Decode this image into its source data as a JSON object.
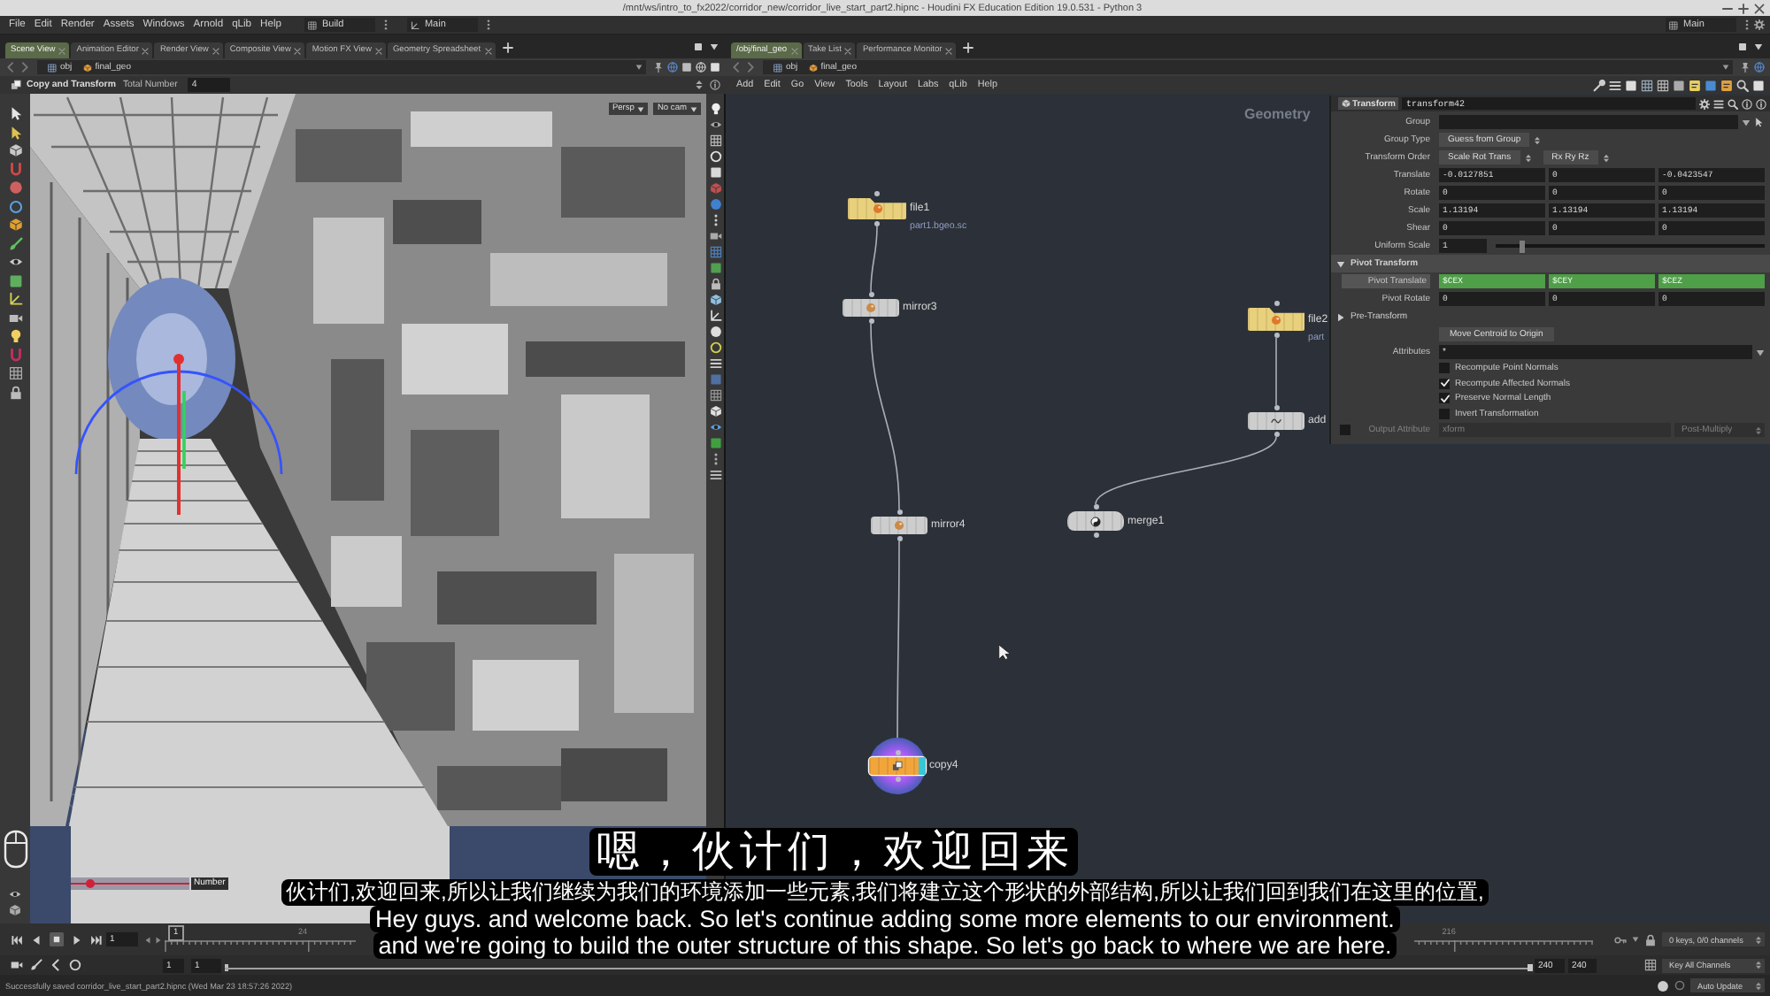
{
  "window": {
    "title": "/mnt/ws/intro_to_fx2022/corridor_new/corridor_live_start_part2.hipnc - Houdini FX Education Edition 19.0.531 - Python 3"
  },
  "menu": [
    "File",
    "Edit",
    "Render",
    "Assets",
    "Windows",
    "Arnold",
    "qLib",
    "Help"
  ],
  "desktops": [
    "Build",
    "Main"
  ],
  "desktop_right": "Main",
  "left_pane": {
    "tabs": [
      {
        "label": "Scene View",
        "selected": true
      },
      {
        "label": "Animation Editor",
        "selected": false
      },
      {
        "label": "Render View",
        "selected": false
      },
      {
        "label": "Composite View",
        "selected": false
      },
      {
        "label": "Motion FX View",
        "selected": false
      },
      {
        "label": "Geometry Spreadsheet",
        "selected": false
      }
    ],
    "path": [
      "obj",
      "final_geo"
    ],
    "tool": {
      "name": "Copy and Transform",
      "param_label": "Total Number",
      "param_value": "4"
    },
    "viewport": {
      "camera_menus": [
        "Persp",
        "No cam"
      ],
      "handle": {
        "label": "Number",
        "level": 0.16
      }
    }
  },
  "right_pane": {
    "tabs": [
      {
        "label": "/obj/final_geo",
        "selected": true
      },
      {
        "label": "Take List",
        "selected": false
      },
      {
        "label": "Performance Monitor",
        "selected": false
      }
    ],
    "path": [
      "obj",
      "final_geo"
    ],
    "menu": [
      "Add",
      "Edit",
      "Go",
      "View",
      "Tools",
      "Layout",
      "Labs",
      "qLib",
      "Help"
    ],
    "network": {
      "context": "Geometry",
      "nodes": [
        {
          "kind": "file",
          "name": "file1",
          "detail": "part1.bgeo.sc",
          "color": "#e8d07c",
          "selected": false,
          "display": false
        },
        {
          "kind": "mirror",
          "name": "mirror3",
          "color": "#cdcdcd",
          "selected": false,
          "display": false
        },
        {
          "kind": "file",
          "name": "file2",
          "detail": "part",
          "color": "#e8d07c",
          "selected": false,
          "display": false
        },
        {
          "kind": "add",
          "name": "add",
          "color": "#cdcdcd",
          "selected": false,
          "display": false
        },
        {
          "kind": "merge",
          "name": "merge1",
          "color": "#cdcdcd",
          "selected": false,
          "display": false
        },
        {
          "kind": "mirror",
          "name": "mirror4",
          "color": "#cdcdcd",
          "selected": false,
          "display": false
        },
        {
          "kind": "copy",
          "name": "copy4",
          "color": "#f2a53a",
          "selected": true,
          "display": true
        }
      ]
    },
    "parameters": {
      "node_type": "Transform",
      "node_name": "transform42",
      "rows": [
        {
          "kind": "group",
          "label": "Group"
        },
        {
          "kind": "menu",
          "label": "Group Type",
          "values": [
            "Guess from Group"
          ]
        },
        {
          "kind": "menu",
          "label": "Transform Order",
          "values": [
            "Scale Rot Trans",
            "Rx Ry Rz"
          ]
        },
        {
          "kind": "vector",
          "label": "Translate",
          "values": [
            "-0.0127851",
            "0",
            "-0.0423547"
          ],
          "expression": false
        },
        {
          "kind": "vector",
          "label": "Rotate",
          "values": [
            "0",
            "0",
            "0"
          ],
          "expression": false
        },
        {
          "kind": "vector",
          "label": "Scale",
          "values": [
            "1.13194",
            "1.13194",
            "1.13194"
          ],
          "expression": false
        },
        {
          "kind": "vector",
          "label": "Shear",
          "values": [
            "0",
            "0",
            "0"
          ],
          "expression": false
        },
        {
          "kind": "slider",
          "label": "Uniform Scale",
          "value": "1",
          "level": 0.1
        },
        {
          "kind": "section",
          "label": "Pivot Transform",
          "expanded": true
        },
        {
          "kind": "vector",
          "label": "Pivot Translate",
          "values": [
            "$CEX",
            "$CEY",
            "$CEZ"
          ],
          "expression": true
        },
        {
          "kind": "vector",
          "label": "Pivot Rotate",
          "values": [
            "0",
            "0",
            "0"
          ],
          "expression": false
        },
        {
          "kind": "section",
          "label": "Pre-Transform",
          "expanded": false
        },
        {
          "kind": "button",
          "label": "Move Centroid to Origin"
        },
        {
          "kind": "field",
          "label": "Attributes",
          "value": "*"
        },
        {
          "kind": "checkbox",
          "label": "Recompute Point Normals",
          "checked": false
        },
        {
          "kind": "checkbox",
          "label": "Recompute Affected Normals",
          "checked": true
        },
        {
          "kind": "checkbox",
          "label": "Preserve Normal Length",
          "checked": true
        },
        {
          "kind": "checkbox",
          "label": "Invert Transformation",
          "checked": false
        },
        {
          "kind": "toggle_field",
          "label": "Output Attribute",
          "checked": false,
          "disabled": true,
          "value": "xform",
          "menu": "Post-Multiply"
        }
      ]
    }
  },
  "captions": {
    "headline": "嗯，伙计们，欢迎回来",
    "chinese": "伙计们,欢迎回来,所以让我们继续为我们的环境添加一些元素,我们将建立这个形状的外部结构,所以让我们回到我们在这里的位置,",
    "english": [
      "Hey guys. and welcome back. So let's continue adding some more elements to our environment.",
      "and we're going to build the outer structure of this shape. So let's go back to where we are here."
    ]
  },
  "timeline": {
    "frame": "1",
    "marker": "1",
    "tick_labels": [
      "24",
      "216"
    ],
    "range": [
      "1",
      "1",
      "240",
      "240"
    ],
    "range_slider": {
      "level": 1
    },
    "keys": "0 keys, 0/0 channels",
    "key_mode": "Key All Channels",
    "update_mode": "Auto Update"
  },
  "status_bar": "Successfully saved corridor_live_start_part2.hipnc (Wed Mar 23 18:57:26 2022)"
}
